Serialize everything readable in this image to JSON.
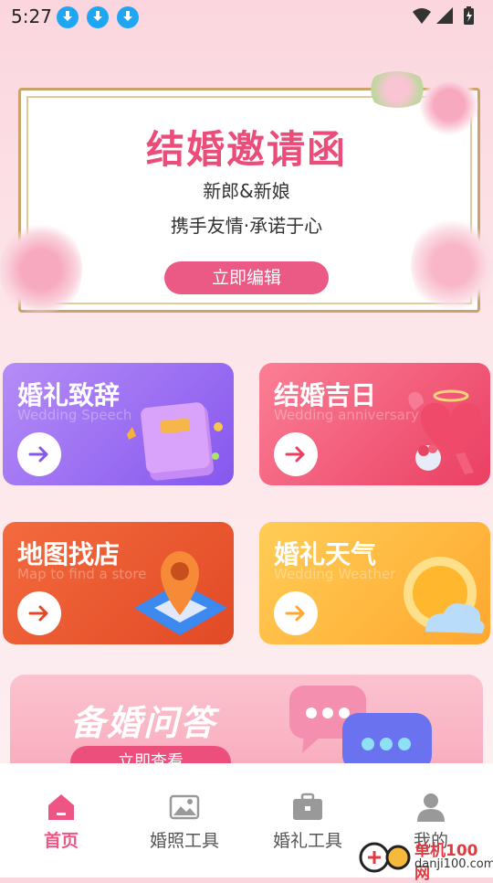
{
  "status_bar": {
    "time": "5:27",
    "icons": [
      "download-icon",
      "download-icon",
      "download-icon",
      "wifi-icon",
      "signal-icon",
      "battery-icon"
    ]
  },
  "invitation": {
    "title": "结婚邀请函",
    "line1": "新郎&新娘",
    "line2": "携手友情·承诺于心",
    "button_label": "立即编辑",
    "accent_color": "#ea4d7a"
  },
  "features": [
    {
      "title": "婚礼致辞",
      "subtitle": "Wedding Speech",
      "icon": "book-icon",
      "color": "#9a6bf2"
    },
    {
      "title": "结婚吉日",
      "subtitle": "Wedding anniversary",
      "icon": "heart-balloon-icon",
      "color": "#f05a76"
    },
    {
      "title": "地图找店",
      "subtitle": "Map to find a store",
      "icon": "map-pin-icon",
      "color": "#ea5a30"
    },
    {
      "title": "婚礼天气",
      "subtitle": "Wedding Weather",
      "icon": "sun-cloud-icon",
      "color": "#ffb93f"
    }
  ],
  "banner": {
    "title": "备婚问答",
    "button_label": "立即查看",
    "icon": "chat-bubbles-icon"
  },
  "bottom_nav": {
    "items": [
      {
        "label": "首页",
        "icon": "home-icon",
        "active": true
      },
      {
        "label": "婚照工具",
        "icon": "image-icon",
        "active": false
      },
      {
        "label": "婚礼工具",
        "icon": "briefcase-icon",
        "active": false
      },
      {
        "label": "我的",
        "icon": "person-icon",
        "active": false
      }
    ],
    "active_color": "#ef5584"
  },
  "watermark": {
    "brand": "单机100网",
    "domain": "danji100.com"
  }
}
